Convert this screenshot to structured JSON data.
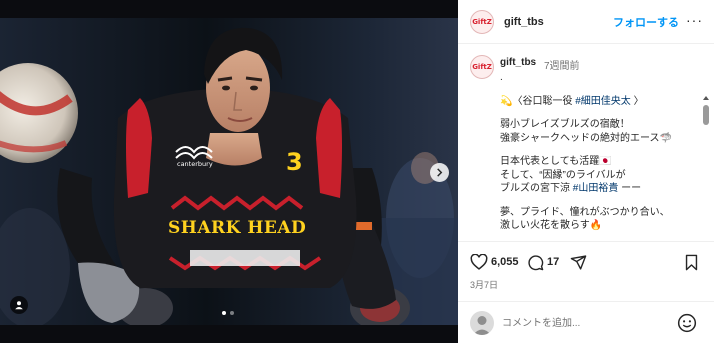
{
  "post": {
    "username": "gift_tbs",
    "avatar_text": "GiftZ",
    "follow_label": "フォローする",
    "more_label": "···"
  },
  "caption": {
    "username": "gift_tbs",
    "time": "7週間前",
    "lines": [
      {
        "type": "text",
        "text": "."
      },
      {
        "type": "gap"
      },
      {
        "type": "mixed",
        "prefix": "💫〈谷口聡一役 ",
        "tag": "#細田佳央太",
        "suffix": " 〉"
      },
      {
        "type": "gap"
      },
      {
        "type": "text",
        "text": "弱小ブレイズブルズの宿敵！"
      },
      {
        "type": "text",
        "text": "強豪シャークヘッドの絶対的エース🦈"
      },
      {
        "type": "gap"
      },
      {
        "type": "text",
        "text": "日本代表としても活躍🇯🇵"
      },
      {
        "type": "text",
        "text": "そして、“因縁”のライバルが"
      },
      {
        "type": "mixed",
        "prefix": "ブルズの宮下涼 ",
        "tag": "#山田裕貴",
        "suffix": " ーー"
      },
      {
        "type": "gap"
      },
      {
        "type": "text",
        "text": "夢、プライド、憧れがぶつかり合い、"
      },
      {
        "type": "text",
        "text": "激しい火花を散らす🔥"
      }
    ]
  },
  "photo": {
    "jersey_text": "SHARK HEAD",
    "jersey_number": "3",
    "brand_text": "canterbury"
  },
  "actions": {
    "like_count": "6,055",
    "comment_count": "17",
    "like_icon": "heart-icon",
    "comment_icon": "comment-bubble-icon",
    "share_icon": "paper-plane-icon",
    "save_icon": "bookmark-icon"
  },
  "date": "3月7日",
  "comment": {
    "placeholder": "コメントを追加...",
    "emoji_icon": "smiley-icon"
  },
  "carousel": {
    "total": 2,
    "active": 0
  },
  "colors": {
    "accent": "#0095f6",
    "jersey_red": "#c8202c",
    "jersey_yellow": "#ffd21f",
    "hashtag": "#00376b"
  }
}
